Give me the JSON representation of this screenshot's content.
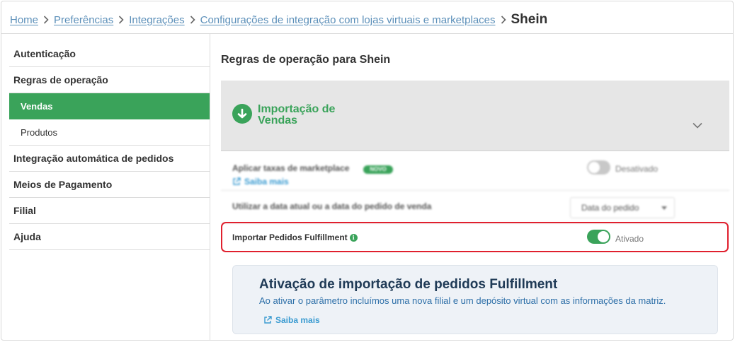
{
  "breadcrumb": {
    "items": [
      "Home",
      "Preferências",
      "Integrações",
      "Configurações de integração com lojas virtuais e marketplaces"
    ],
    "current": "Shein"
  },
  "sidebar": {
    "items": [
      {
        "label": "Autenticação",
        "type": "main"
      },
      {
        "label": "Regras de operação",
        "type": "main"
      },
      {
        "label": "Vendas",
        "type": "active"
      },
      {
        "label": "Produtos",
        "type": "sub"
      },
      {
        "label": "Integração automática de pedidos",
        "type": "main"
      },
      {
        "label": "Meios de Pagamento",
        "type": "main"
      },
      {
        "label": "Filial",
        "type": "main"
      },
      {
        "label": "Ajuda",
        "type": "main"
      }
    ]
  },
  "main": {
    "title": "Regras de operação para Shein",
    "import_section": {
      "title": "Importação de Vendas"
    },
    "options": {
      "marketplace_fees": {
        "label": "Aplicar taxas de marketplace",
        "badge": "NOVO",
        "link": "Saiba mais",
        "toggle_state": "Desativado"
      },
      "date_option": {
        "label": "Utilizar a data atual ou a data do pedido de venda",
        "select_value": "Data do pedido"
      },
      "fulfillment": {
        "label": "Importar Pedidos Fulfillment",
        "info": "i",
        "toggle_state": "Ativado"
      }
    },
    "info_card": {
      "title": "Ativação de importação de pedidos Fulfillment",
      "description": "Ao ativar o parâmetro incluímos uma nova filial e um depósito virtual com as informações da matriz.",
      "link": "Saiba mais"
    }
  },
  "colors": {
    "accent": "#3aa35a",
    "highlight": "#e0202e",
    "link": "#5b8fb9"
  },
  "icons": [
    "chevron-right-icon",
    "arrow-down-circle-icon",
    "chevron-down-icon",
    "external-link-icon",
    "info-icon",
    "caret-down-icon"
  ]
}
